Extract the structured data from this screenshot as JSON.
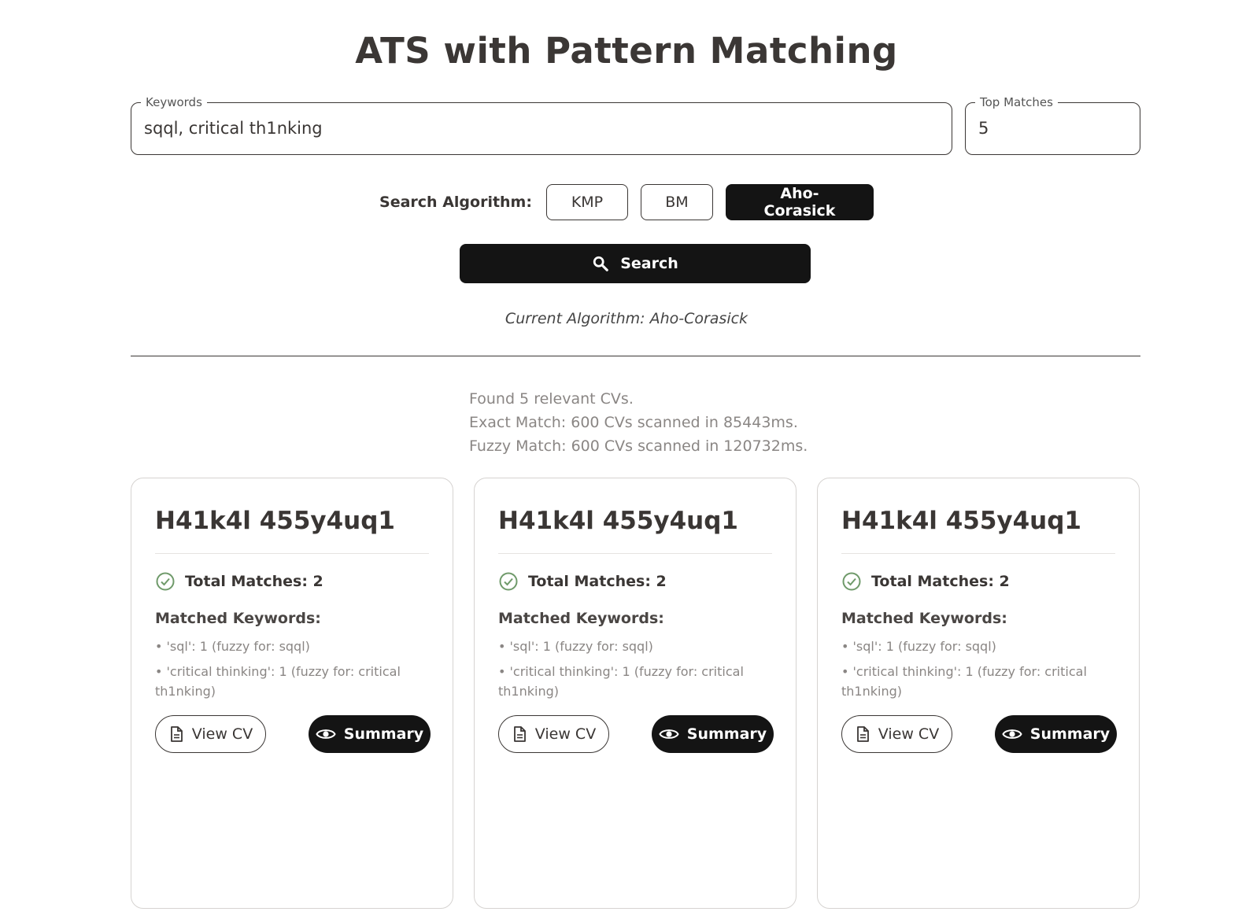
{
  "page": {
    "title": "ATS with Pattern Matching"
  },
  "keywords_field": {
    "label": "Keywords",
    "value": "sqql, critical th1nking"
  },
  "top_matches_field": {
    "label": "Top Matches",
    "value": "5"
  },
  "algorithm": {
    "label": "Search Algorithm:",
    "options": [
      "KMP",
      "BM",
      "Aho-Corasick"
    ],
    "selected": "Aho-Corasick",
    "current_text": "Current Algorithm: Aho-Corasick"
  },
  "search_button": {
    "label": "Search",
    "icon": "search-icon"
  },
  "stats": {
    "found": "Found 5 relevant CVs.",
    "exact": "Exact Match: 600 CVs scanned in 85443ms.",
    "fuzzy": "Fuzzy Match: 600 CVs scanned in 120732ms."
  },
  "colors": {
    "accent": "#141414",
    "check": "#6f9a6a",
    "muted": "#8a8684"
  },
  "results": [
    {
      "name": "H41k4l 455y4uq1",
      "total": "Total Matches: 2",
      "matched_title": "Matched Keywords:",
      "keywords": [
        "• 'sql': 1 (fuzzy for: sqql)",
        "• 'critical thinking': 1 (fuzzy for: critical th1nking)"
      ],
      "view_label": "View CV",
      "summary_label": "Summary"
    },
    {
      "name": "H41k4l 455y4uq1",
      "total": "Total Matches: 2",
      "matched_title": "Matched Keywords:",
      "keywords": [
        "• 'sql': 1 (fuzzy for: sqql)",
        "• 'critical thinking': 1 (fuzzy for: critical th1nking)"
      ],
      "view_label": "View CV",
      "summary_label": "Summary"
    },
    {
      "name": "H41k4l 455y4uq1",
      "total": "Total Matches: 2",
      "matched_title": "Matched Keywords:",
      "keywords": [
        "• 'sql': 1 (fuzzy for: sqql)",
        "• 'critical thinking': 1 (fuzzy for: critical th1nking)"
      ],
      "view_label": "View CV",
      "summary_label": "Summary"
    }
  ]
}
